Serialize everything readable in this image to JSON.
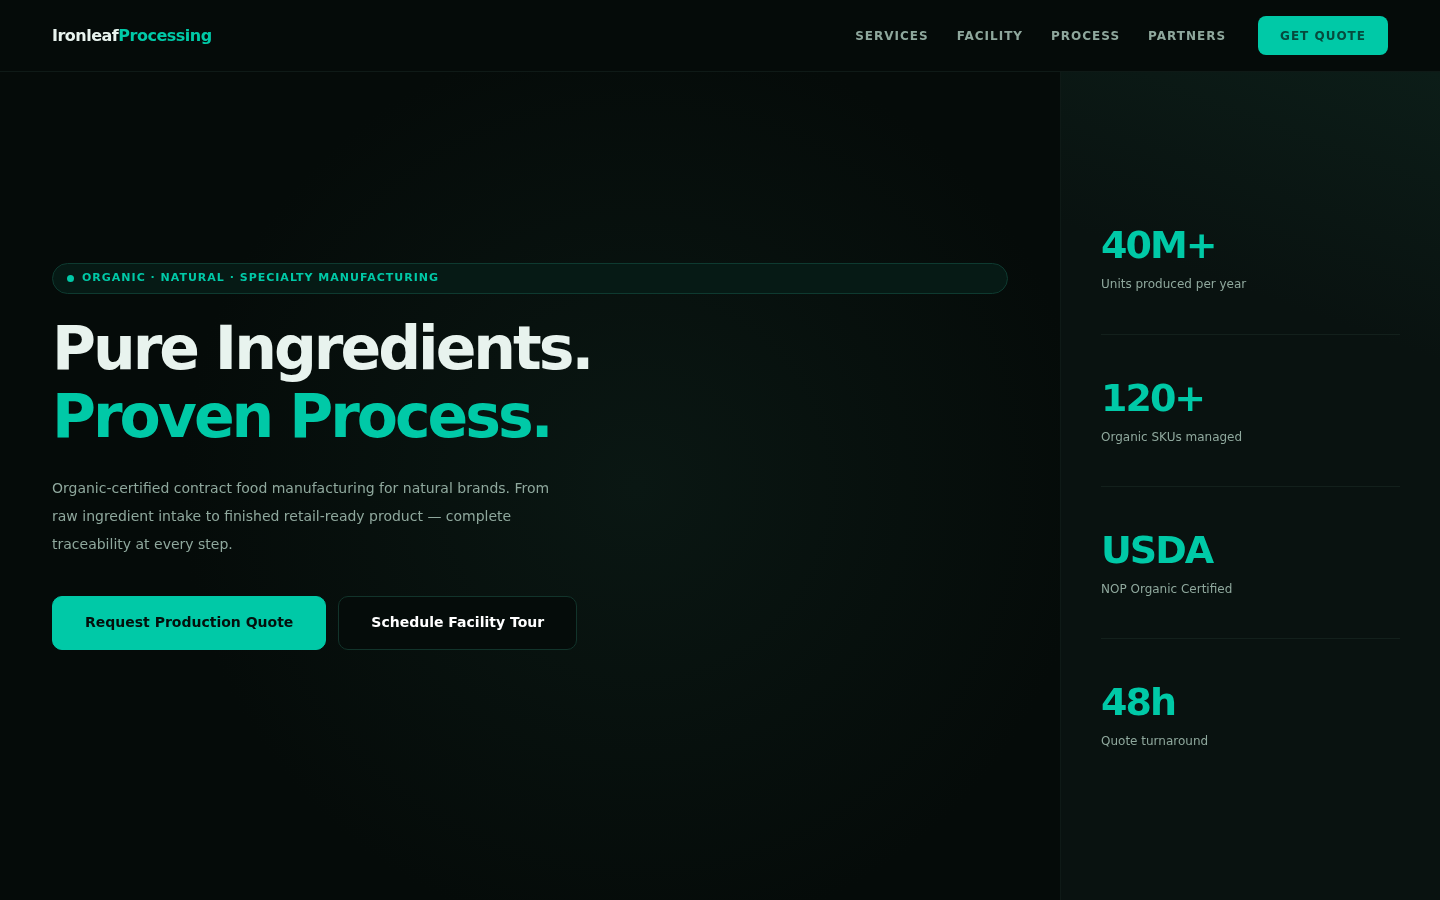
{
  "header": {
    "logo": {
      "primary": "Ironleaf",
      "accent": "Processing"
    },
    "nav": [
      "SERVICES",
      "FACILITY",
      "PROCESS",
      "PARTNERS"
    ],
    "cta": "GET QUOTE"
  },
  "hero": {
    "eyebrow": "ORGANIC · NATURAL · SPECIALTY MANUFACTURING",
    "headline": [
      "Pure Ingredients.",
      "Proven Process."
    ],
    "lead": "Organic-certified contract food manufacturing for natural brands. From raw ingredient intake to finished retail-ready product — complete traceability at every step.",
    "buttons": [
      {
        "label": "Request Production Quote",
        "kind": "primary"
      },
      {
        "label": "Schedule Facility Tour",
        "kind": "secondary"
      }
    ]
  },
  "stats": [
    {
      "value": "40M+",
      "label": "Units produced per year"
    },
    {
      "value": "120+",
      "label": "Organic SKUs managed"
    },
    {
      "value": "USDA",
      "label": "NOP Organic Certified"
    },
    {
      "value": "48h",
      "label": "Quote turnaround"
    }
  ]
}
